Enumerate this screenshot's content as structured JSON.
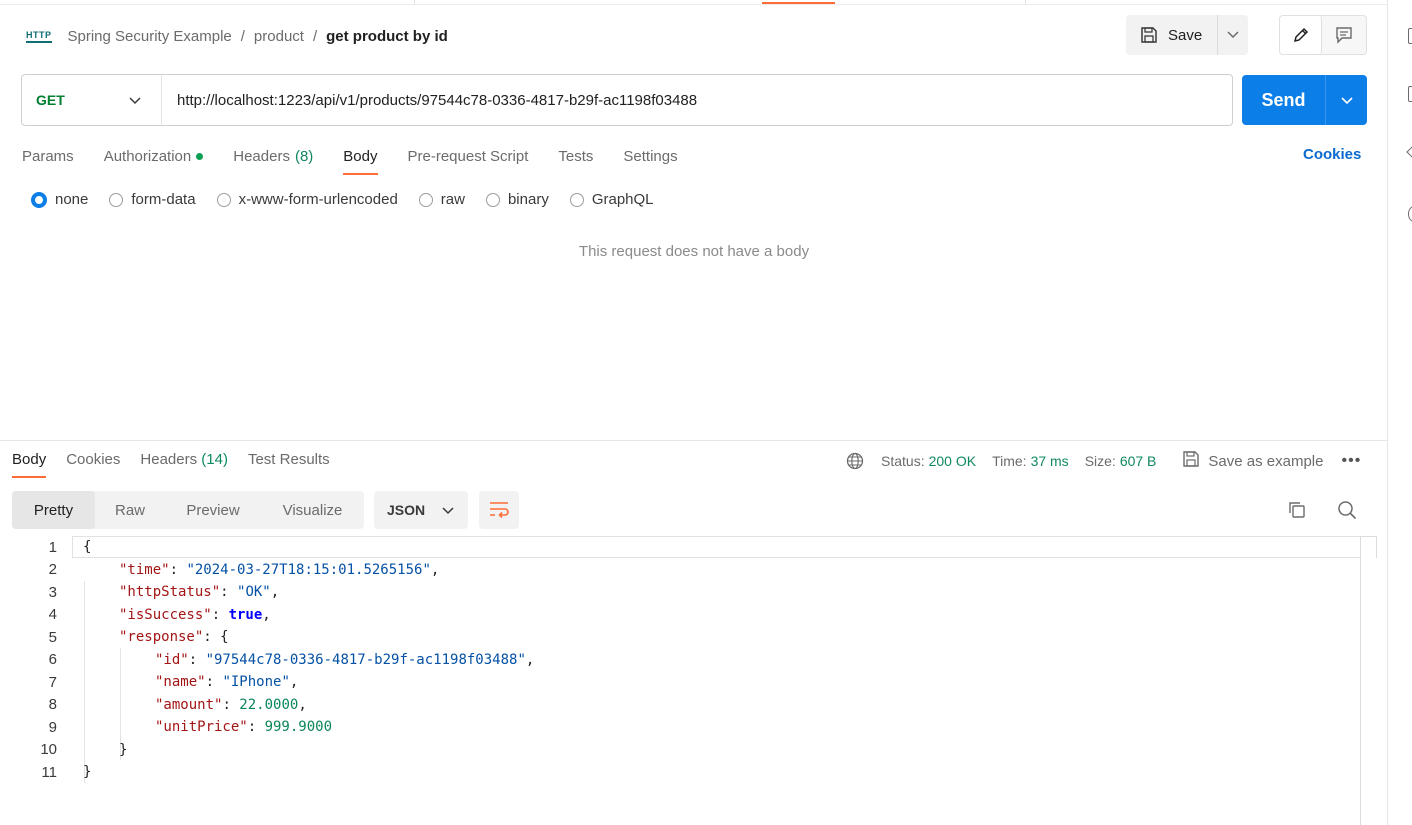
{
  "breadcrumb": {
    "icon_text": "HTTP",
    "items": [
      "Spring Security Example",
      "product",
      "get product by id"
    ]
  },
  "header": {
    "save_label": "Save"
  },
  "request": {
    "method": "GET",
    "url": "http://localhost:1223/api/v1/products/97544c78-0336-4817-b29f-ac1198f03488",
    "send_label": "Send",
    "tabs": [
      {
        "label": "Params",
        "count": "",
        "dot": false
      },
      {
        "label": "Authorization",
        "count": "",
        "dot": true
      },
      {
        "label": "Headers",
        "count": "(8)",
        "dot": false
      },
      {
        "label": "Body",
        "count": "",
        "dot": false,
        "active": true
      },
      {
        "label": "Pre-request Script",
        "count": "",
        "dot": false
      },
      {
        "label": "Tests",
        "count": "",
        "dot": false
      },
      {
        "label": "Settings",
        "count": "",
        "dot": false
      }
    ],
    "cookies_label": "Cookies",
    "body_types": [
      "none",
      "form-data",
      "x-www-form-urlencoded",
      "raw",
      "binary",
      "GraphQL"
    ],
    "body_selected": "none",
    "no_body_text": "This request does not have a body"
  },
  "response": {
    "tabs": [
      {
        "label": "Body",
        "count": "",
        "active": true
      },
      {
        "label": "Cookies",
        "count": ""
      },
      {
        "label": "Headers",
        "count": "(14)"
      },
      {
        "label": "Test Results",
        "count": ""
      }
    ],
    "status_label": "Status:",
    "status_value": "200 OK",
    "time_label": "Time:",
    "time_value": "37 ms",
    "size_label": "Size:",
    "size_value": "607 B",
    "save_example_label": "Save as example",
    "more_label": "•••",
    "views": [
      "Pretty",
      "Raw",
      "Preview",
      "Visualize"
    ],
    "active_view": "Pretty",
    "format": "JSON",
    "body_lines": [
      {
        "n": "1",
        "indent": 0,
        "parts": [
          {
            "t": "p",
            "v": "{"
          }
        ]
      },
      {
        "n": "2",
        "indent": 1,
        "parts": [
          {
            "t": "k",
            "v": "\"time\""
          },
          {
            "t": "p",
            "v": ": "
          },
          {
            "t": "s",
            "v": "\"2024-03-27T18:15:01.5265156\""
          },
          {
            "t": "p",
            "v": ","
          }
        ]
      },
      {
        "n": "3",
        "indent": 1,
        "parts": [
          {
            "t": "k",
            "v": "\"httpStatus\""
          },
          {
            "t": "p",
            "v": ": "
          },
          {
            "t": "s",
            "v": "\"OK\""
          },
          {
            "t": "p",
            "v": ","
          }
        ]
      },
      {
        "n": "4",
        "indent": 1,
        "parts": [
          {
            "t": "k",
            "v": "\"isSuccess\""
          },
          {
            "t": "p",
            "v": ": "
          },
          {
            "t": "b",
            "v": "true"
          },
          {
            "t": "p",
            "v": ","
          }
        ]
      },
      {
        "n": "5",
        "indent": 1,
        "parts": [
          {
            "t": "k",
            "v": "\"response\""
          },
          {
            "t": "p",
            "v": ": {"
          }
        ]
      },
      {
        "n": "6",
        "indent": 2,
        "parts": [
          {
            "t": "k",
            "v": "\"id\""
          },
          {
            "t": "p",
            "v": ": "
          },
          {
            "t": "s",
            "v": "\"97544c78-0336-4817-b29f-ac1198f03488\""
          },
          {
            "t": "p",
            "v": ","
          }
        ]
      },
      {
        "n": "7",
        "indent": 2,
        "parts": [
          {
            "t": "k",
            "v": "\"name\""
          },
          {
            "t": "p",
            "v": ": "
          },
          {
            "t": "s",
            "v": "\"IPhone\""
          },
          {
            "t": "p",
            "v": ","
          }
        ]
      },
      {
        "n": "8",
        "indent": 2,
        "parts": [
          {
            "t": "k",
            "v": "\"amount\""
          },
          {
            "t": "p",
            "v": ": "
          },
          {
            "t": "n",
            "v": "22.0000"
          },
          {
            "t": "p",
            "v": ","
          }
        ]
      },
      {
        "n": "9",
        "indent": 2,
        "parts": [
          {
            "t": "k",
            "v": "\"unitPrice\""
          },
          {
            "t": "p",
            "v": ": "
          },
          {
            "t": "n",
            "v": "999.9000"
          }
        ]
      },
      {
        "n": "10",
        "indent": 1,
        "parts": [
          {
            "t": "p",
            "v": "}"
          }
        ]
      },
      {
        "n": "11",
        "indent": 0,
        "parts": [
          {
            "t": "p",
            "v": "}"
          }
        ]
      }
    ]
  },
  "icons": [
    "http-icon",
    "save-icon",
    "chevron-down-icon",
    "pencil-icon",
    "comment-icon",
    "globe-icon",
    "wrap-lines-icon",
    "copy-icon",
    "search-icon"
  ],
  "colors": {
    "accent": "#ff6c37",
    "send": "#0c7ee8",
    "method_get": "#007f31",
    "count_green": "#0f8a5f",
    "link": "#0b69cf"
  }
}
